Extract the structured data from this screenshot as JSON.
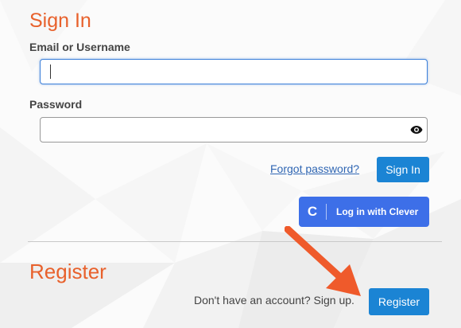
{
  "sign_in": {
    "title": "Sign In",
    "email_label": "Email or Username",
    "email_value": "",
    "password_label": "Password",
    "password_value": "",
    "forgot_link": "Forgot password?",
    "submit_label": "Sign In",
    "clever_icon": "C",
    "clever_label": "Log in with Clever"
  },
  "register": {
    "title": "Register",
    "prompt": "Don't have an account? Sign up.",
    "button_label": "Register"
  },
  "colors": {
    "heading": "#e8612c",
    "primary_button": "#1b84d4",
    "clever_button": "#3d6fe8",
    "annotation_arrow": "#ef5a2b",
    "link": "#2f66b3"
  },
  "icons": {
    "password_toggle": "eye-icon",
    "clever_logo": "clever-logo-icon",
    "annotation": "arrow-icon"
  }
}
